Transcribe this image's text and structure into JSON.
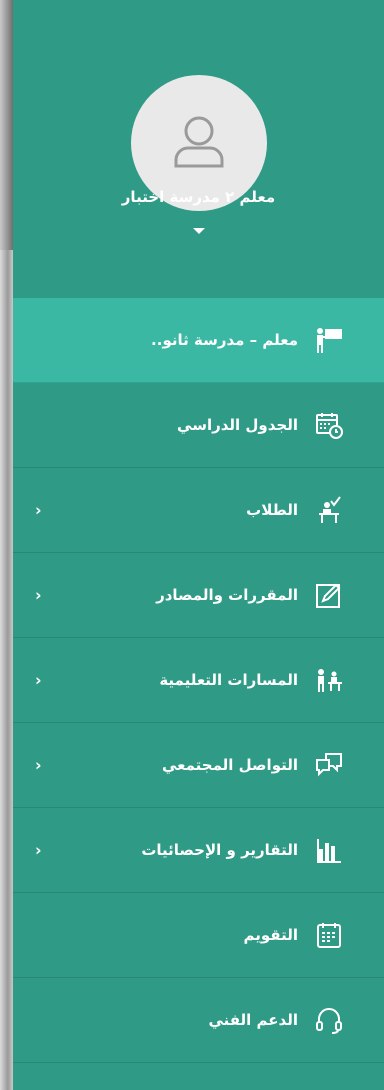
{
  "profile": {
    "name": "معلم ٢ مدرسة اختبار",
    "avatar_icon": "user-icon"
  },
  "menu": [
    {
      "label": "معلم – مدرسة ثانو..",
      "icon": "teacher-board-icon",
      "active": true,
      "has_submenu": false
    },
    {
      "label": "الجدول الدراسي",
      "icon": "calendar-clock-icon",
      "active": false,
      "has_submenu": false
    },
    {
      "label": "الطلاب",
      "icon": "student-desk-icon",
      "active": false,
      "has_submenu": true
    },
    {
      "label": "المقررات والمصادر",
      "icon": "edit-note-icon",
      "active": false,
      "has_submenu": true
    },
    {
      "label": "المسارات التعليمية",
      "icon": "classroom-icon",
      "active": false,
      "has_submenu": true
    },
    {
      "label": "التواصل المجتمعي",
      "icon": "chat-bubbles-icon",
      "active": false,
      "has_submenu": true
    },
    {
      "label": "التقارير و الإحصائيات",
      "icon": "bar-chart-icon",
      "active": false,
      "has_submenu": true
    },
    {
      "label": "التقويم",
      "icon": "calendar-icon",
      "active": false,
      "has_submenu": false
    },
    {
      "label": "الدعم الفني",
      "icon": "headset-icon",
      "active": false,
      "has_submenu": false
    }
  ],
  "colors": {
    "sidebar_bg": "#2f9a86",
    "active_bg": "#3ab8a3",
    "avatar_bg": "#e9e9e9"
  }
}
